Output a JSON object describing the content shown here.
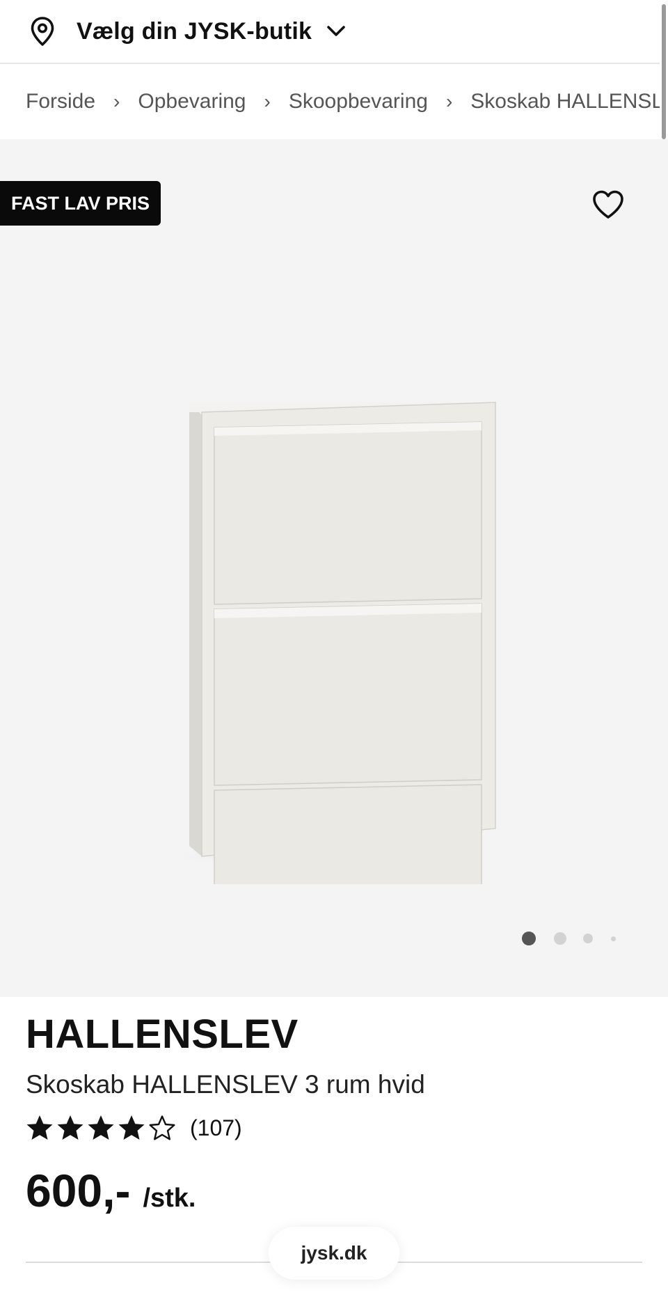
{
  "store_bar": {
    "icon": "map-pin-icon",
    "label": "Vælg din JYSK-butik",
    "chevron_icon": "chevron-down-icon"
  },
  "breadcrumb": {
    "items": [
      "Forside",
      "Opbevaring",
      "Skoopbevaring",
      "Skoskab HALLENSLEV"
    ],
    "separator": "›"
  },
  "gallery": {
    "badge": "FAST LAV PRIS",
    "wishlist_icon": "heart-icon",
    "slide_count": 4,
    "active_slide": 1
  },
  "product": {
    "brand": "HALLENSLEV",
    "name": "Skoskab HALLENSLEV 3 rum hvid",
    "rating": 4,
    "rating_max": 5,
    "review_count": "(107)",
    "price": "600,-",
    "unit": "/stk."
  },
  "browser": {
    "domain": "jysk.dk"
  },
  "colors": {
    "badge_bg": "#0a0a0a",
    "gallery_bg": "#f4f4f4",
    "text": "#111111",
    "muted": "#555555"
  }
}
